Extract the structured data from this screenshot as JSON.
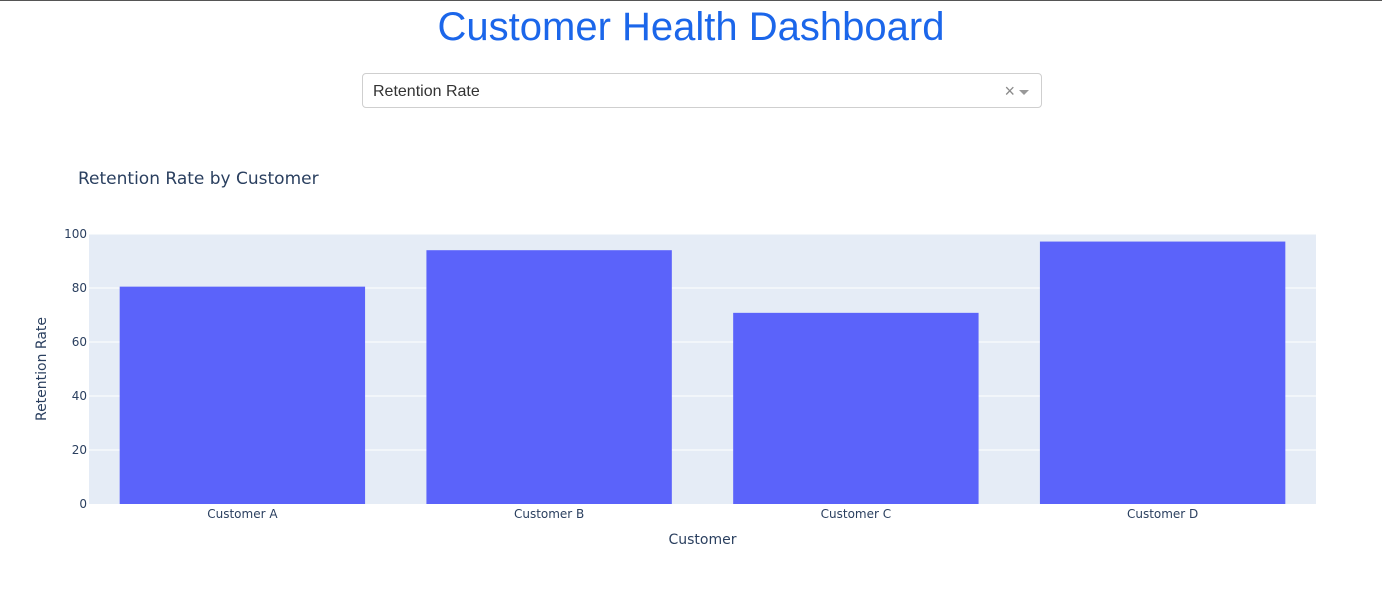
{
  "header": {
    "title": "Customer Health Dashboard"
  },
  "dropdown": {
    "selected": "Retention Rate",
    "clear_glyph": "×"
  },
  "colors": {
    "title": "#1b66ea",
    "bar": "#5b63fa",
    "plot_bg": "#e5ecf6",
    "grid": "#ffffff",
    "text": "#2a3f5f"
  },
  "chart_data": {
    "type": "bar",
    "title": "Retention Rate by Customer",
    "xlabel": "Customer",
    "ylabel": "Retention Rate",
    "categories": [
      "Customer A",
      "Customer B",
      "Customer C",
      "Customer D"
    ],
    "values": [
      80.5,
      94,
      70.8,
      97.2
    ],
    "ylim": [
      0,
      100
    ],
    "yticks": [
      0,
      20,
      40,
      60,
      80,
      100
    ],
    "grid": true
  }
}
